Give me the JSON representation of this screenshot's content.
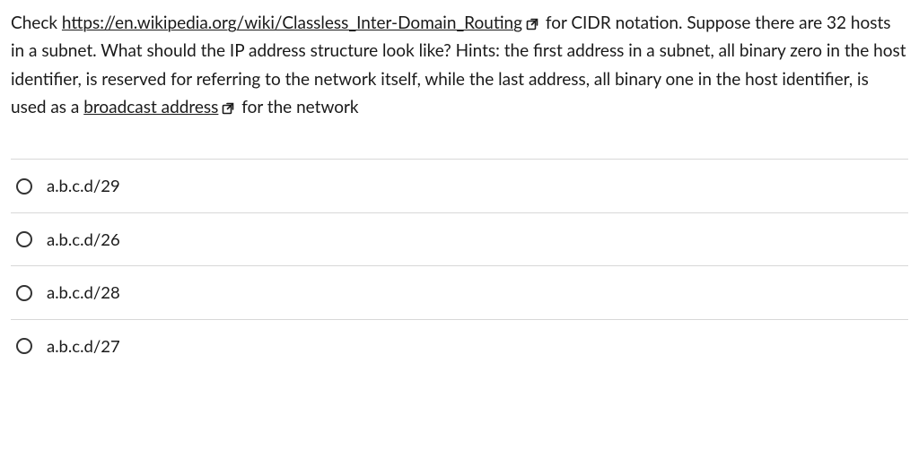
{
  "question": {
    "pre_link1": "Check ",
    "link1_text": "https://en.wikipedia.org/wiki/Classless_Inter-Domain_Routing",
    "mid1": " for CIDR notation. Suppose there are 32 hosts in a subnet. What should the IP address structure look like? Hints: the first address in a subnet, all binary zero in the host identifier, is reserved for referring to the network itself, while the last address, all binary one in the host identifier, is used as a ",
    "link2_text": "broadcast address",
    "post_link2": " for the network"
  },
  "options": [
    {
      "label": "a.b.c.d/29"
    },
    {
      "label": "a.b.c.d/26"
    },
    {
      "label": "a.b.c.d/28"
    },
    {
      "label": "a.b.c.d/27"
    }
  ]
}
